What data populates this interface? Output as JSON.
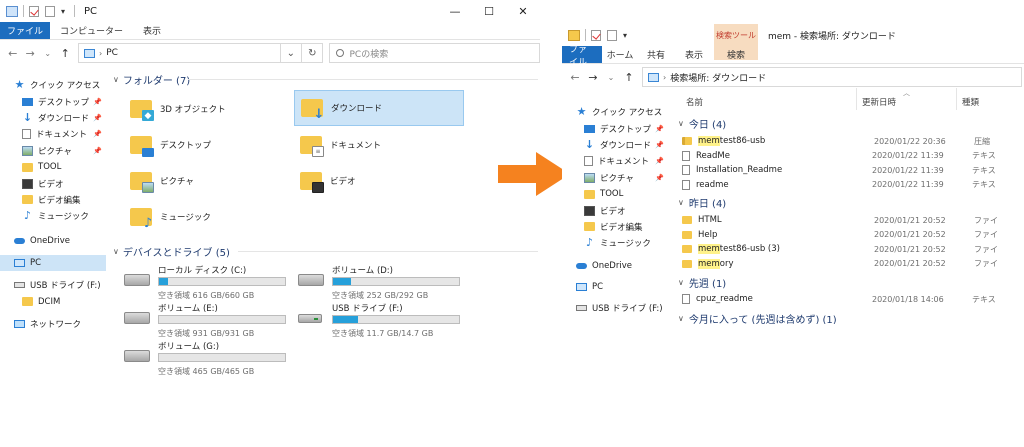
{
  "left_window": {
    "title": "PC",
    "window_controls": [
      "—",
      "☐",
      "✕"
    ],
    "ribbon_tabs": [
      "ファイル",
      "コンピューター",
      "表示"
    ],
    "address": {
      "path": "PC",
      "search_placeholder": "PCの検索"
    },
    "nav": {
      "quick_access": "クイック アクセス",
      "items": [
        {
          "label": "デスクトップ",
          "icon": "desktop-icon",
          "pinned": true
        },
        {
          "label": "ダウンロード",
          "icon": "download-icon",
          "pinned": true
        },
        {
          "label": "ドキュメント",
          "icon": "document-icon",
          "pinned": true
        },
        {
          "label": "ピクチャ",
          "icon": "picture-icon",
          "pinned": true
        },
        {
          "label": "TOOL",
          "icon": "folder-icon",
          "pinned": false
        },
        {
          "label": "ビデオ",
          "icon": "video-icon",
          "pinned": false
        },
        {
          "label": "ビデオ編集",
          "icon": "folder-icon",
          "pinned": false
        },
        {
          "label": "ミュージック",
          "icon": "music-icon",
          "pinned": false
        }
      ],
      "onedrive": "OneDrive",
      "pc": "PC",
      "usb": "USB ドライブ (F:)",
      "dcim": "DCIM",
      "network": "ネットワーク"
    },
    "folders_header": "フォルダー (7)",
    "folders": [
      "3D オブジェクト",
      "ダウンロード",
      "デスクトップ",
      "ドキュメント",
      "ピクチャ",
      "ビデオ",
      "ミュージック"
    ],
    "devices_header": "デバイスとドライブ (5)",
    "drives": [
      {
        "name": "ローカル ディスク (C:)",
        "free": "空き領域 616 GB/660 GB",
        "used_fraction": 0.07
      },
      {
        "name": "ボリューム (D:)",
        "free": "空き領域 252 GB/292 GB",
        "used_fraction": 0.14
      },
      {
        "name": "ボリューム (E:)",
        "free": "空き領域 931 GB/931 GB",
        "used_fraction": 0.0
      },
      {
        "name": "USB ドライブ (F:)",
        "free": "空き領域 11.7 GB/14.7 GB",
        "used_fraction": 0.2
      },
      {
        "name": "ボリューム (G:)",
        "free": "空き領域 465 GB/465 GB",
        "used_fraction": 0.0
      }
    ]
  },
  "arrow_color": "#f5821f",
  "right_window": {
    "title": "mem - 検索場所: ダウンロード",
    "context_tab_label": "検索ツール",
    "ribbon_tabs": [
      "ファイル",
      "ホーム",
      "共有",
      "表示",
      "検索"
    ],
    "address": {
      "path": "検索場所: ダウンロード"
    },
    "columns": [
      "名前",
      "更新日時",
      "種類"
    ],
    "nav": {
      "quick_access": "クイック アクセス",
      "items": [
        {
          "label": "デスクトップ",
          "icon": "desktop-icon",
          "pinned": true
        },
        {
          "label": "ダウンロード",
          "icon": "download-icon",
          "pinned": true
        },
        {
          "label": "ドキュメント",
          "icon": "document-icon",
          "pinned": true
        },
        {
          "label": "ピクチャ",
          "icon": "picture-icon",
          "pinned": true
        },
        {
          "label": "TOOL",
          "icon": "folder-icon",
          "pinned": false
        },
        {
          "label": "ビデオ",
          "icon": "video-icon",
          "pinned": false
        },
        {
          "label": "ビデオ編集",
          "icon": "folder-icon",
          "pinned": false
        },
        {
          "label": "ミュージック",
          "icon": "music-icon",
          "pinned": false
        }
      ],
      "onedrive": "OneDrive",
      "pc": "PC",
      "usb": "USB ドライブ (F:)"
    },
    "groups": [
      {
        "header": "今日 (4)",
        "rows": [
          {
            "hl": "mem",
            "rest": "test86-usb",
            "date": "2020/01/22 20:36",
            "type": "圧縮",
            "icon": "zip"
          },
          {
            "hl": "",
            "rest": "ReadMe",
            "date": "2020/01/22 11:39",
            "type": "テキス",
            "icon": "txt"
          },
          {
            "hl": "",
            "rest": "Installation_Readme",
            "date": "2020/01/22 11:39",
            "type": "テキス",
            "icon": "txt"
          },
          {
            "hl": "",
            "rest": "readme",
            "date": "2020/01/22 11:39",
            "type": "テキス",
            "icon": "txt"
          }
        ]
      },
      {
        "header": "昨日 (4)",
        "rows": [
          {
            "hl": "",
            "rest": "HTML",
            "date": "2020/01/21 20:52",
            "type": "ファイ",
            "icon": "fold"
          },
          {
            "hl": "",
            "rest": "Help",
            "date": "2020/01/21 20:52",
            "type": "ファイ",
            "icon": "fold"
          },
          {
            "hl": "mem",
            "rest": "test86-usb (3)",
            "date": "2020/01/21 20:52",
            "type": "ファイ",
            "icon": "fold"
          },
          {
            "hl": "mem",
            "rest": "ory",
            "date": "2020/01/21 20:52",
            "type": "ファイ",
            "icon": "fold"
          }
        ]
      },
      {
        "header": "先週 (1)",
        "rows": [
          {
            "hl": "",
            "rest": "cpuz_readme",
            "date": "2020/01/18 14:06",
            "type": "テキス",
            "icon": "txt"
          }
        ]
      },
      {
        "header": "今月に入って (先週は含めず) (1)",
        "rows": []
      }
    ]
  }
}
